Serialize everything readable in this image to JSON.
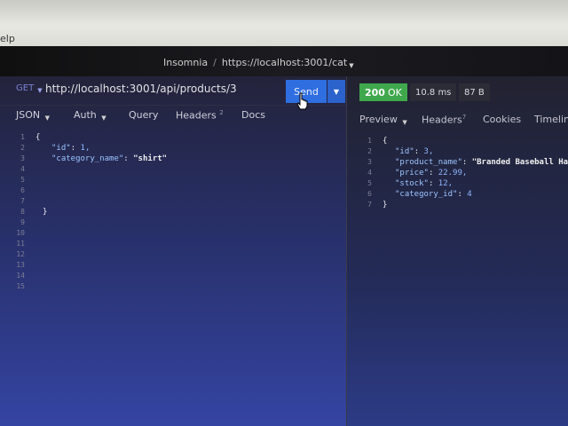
{
  "app": {
    "menu_help": "elp",
    "title_app": "Insomnia",
    "title_separator": "/",
    "workspace": "https://localhost:3001/cat"
  },
  "request": {
    "method": "GET",
    "url": "http://localhost:3001/api/products/3",
    "send_label": "Send",
    "tabs": [
      {
        "label": "JSON"
      },
      {
        "label": "Auth"
      },
      {
        "label": "Query"
      },
      {
        "label": "Headers",
        "count": "2"
      },
      {
        "label": "Docs"
      }
    ],
    "body_lines": [
      {
        "num": "1",
        "text": "{"
      },
      {
        "num": "2",
        "key": "\"id\"",
        "value": "1,"
      },
      {
        "num": "3",
        "key": "\"category_name\"",
        "value": "\"shirt\""
      },
      {
        "num": "4",
        "text": ""
      },
      {
        "num": "5",
        "text": ""
      },
      {
        "num": "6",
        "text": ""
      },
      {
        "num": "7",
        "text": ""
      },
      {
        "num": "8",
        "text": "}"
      },
      {
        "num": "9",
        "text": ""
      },
      {
        "num": "10",
        "text": ""
      },
      {
        "num": "11",
        "text": ""
      },
      {
        "num": "12",
        "text": ""
      },
      {
        "num": "13",
        "text": ""
      },
      {
        "num": "14",
        "text": ""
      },
      {
        "num": "15",
        "text": ""
      }
    ]
  },
  "response": {
    "status_code": "200",
    "status_text": "OK",
    "time": "10.8 ms",
    "size": "87 B",
    "tabs": [
      {
        "label": "Preview"
      },
      {
        "label": "Headers",
        "count": "7"
      },
      {
        "label": "Cookies"
      },
      {
        "label": "Timeline"
      }
    ],
    "body_lines": [
      {
        "num": "1",
        "text": "{"
      },
      {
        "num": "2",
        "key": "\"id\"",
        "value": "3,"
      },
      {
        "num": "3",
        "key": "\"product_name\"",
        "value": "\"Branded Baseball Hat\","
      },
      {
        "num": "4",
        "key": "\"price\"",
        "value": "22.99,"
      },
      {
        "num": "5",
        "key": "\"stock\"",
        "value": "12,"
      },
      {
        "num": "6",
        "key": "\"category_id\"",
        "value": "4"
      },
      {
        "num": "7",
        "text": "}"
      }
    ]
  },
  "colors": {
    "send_button": "#2f6ee0",
    "status_ok": "#3fa84c",
    "method": "#7d83d6"
  }
}
